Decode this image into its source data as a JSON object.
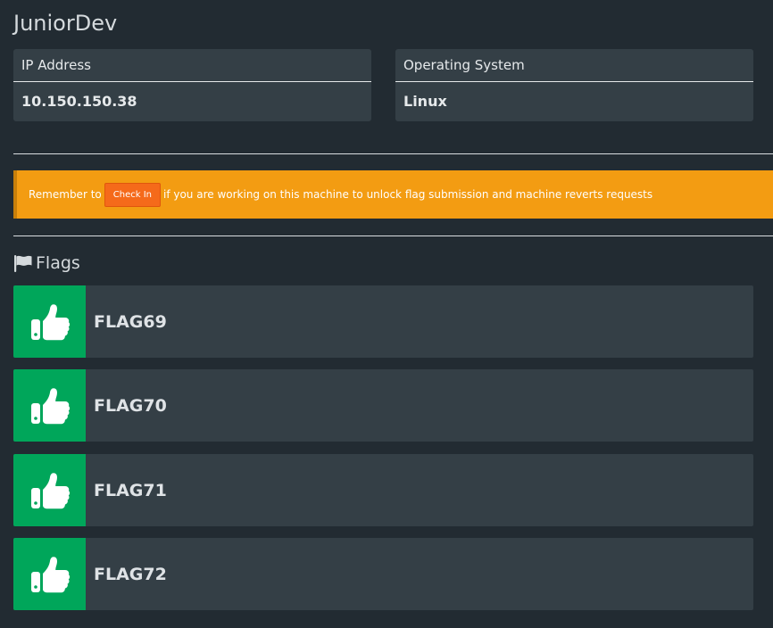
{
  "machine": {
    "title": "JuniorDev",
    "ip_label": "IP Address",
    "ip_value": "10.150.150.38",
    "os_label": "Operating System",
    "os_value": "Linux"
  },
  "alert": {
    "prefix": "Remember to",
    "button_label": "Check In",
    "suffix": "if you are working on this machine to unlock flag submission and machine reverts requests"
  },
  "flags": {
    "heading": "Flags",
    "heading_icon": "flag-icon",
    "items": [
      {
        "name": "FLAG69",
        "icon": "thumbs-up-icon",
        "status_color": "#00a65a"
      },
      {
        "name": "FLAG70",
        "icon": "thumbs-up-icon",
        "status_color": "#00a65a"
      },
      {
        "name": "FLAG71",
        "icon": "thumbs-up-icon",
        "status_color": "#00a65a"
      },
      {
        "name": "FLAG72",
        "icon": "thumbs-up-icon",
        "status_color": "#00a65a"
      }
    ]
  },
  "colors": {
    "background": "#222b32",
    "panel": "#343f46",
    "alert": "#f39c12",
    "check_in_button": "#f56a1a",
    "success": "#00a65a"
  }
}
